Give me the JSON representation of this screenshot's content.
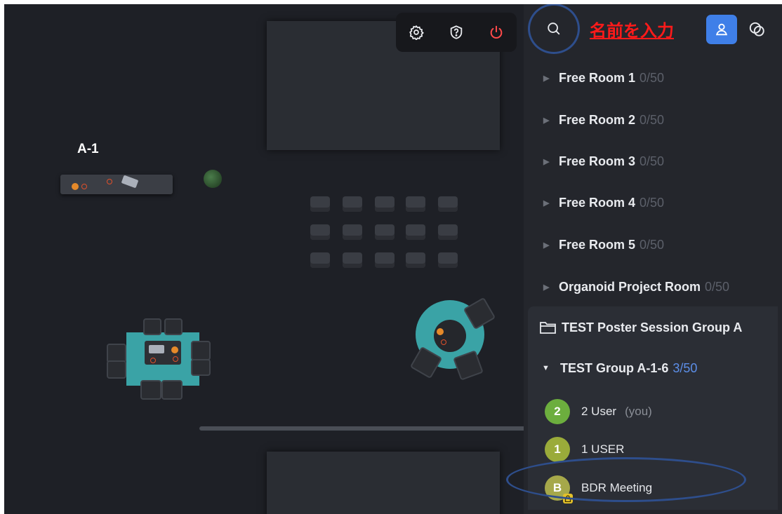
{
  "map": {
    "desk_label": "A-1"
  },
  "toolbar": {
    "settings_icon": "gear-icon",
    "help_icon": "help-icon",
    "power_icon": "power-icon",
    "power_color": "#ff4a4a"
  },
  "header": {
    "search_icon": "search-icon",
    "name_hint": "名前を入力",
    "hint_color": "#ff1a1a",
    "user_icon": "user-icon",
    "user_btn_color": "#3f7fe8",
    "chat_icon": "chat-icon"
  },
  "rooms": [
    {
      "name": "Free Room 1",
      "count": "0/50"
    },
    {
      "name": "Free Room 2",
      "count": "0/50"
    },
    {
      "name": "Free Room 3",
      "count": "0/50"
    },
    {
      "name": "Free Room 4",
      "count": "0/50"
    },
    {
      "name": "Free Room 5",
      "count": "0/50"
    },
    {
      "name": "Organoid Project Room",
      "count": "0/50"
    }
  ],
  "group": {
    "title": "TEST Poster Session Group A",
    "subgroup": {
      "name": "TEST Group A-1-6",
      "count": "3/50"
    },
    "users": [
      {
        "initial": "2",
        "name": "2 User",
        "note": "(you)",
        "color": "#6cae3e"
      },
      {
        "initial": "1",
        "name": "1 USER",
        "note": "",
        "color": "#9aab3a"
      },
      {
        "initial": "B",
        "name": "BDR Meeting",
        "note": "",
        "color": "#a6a84a"
      }
    ]
  }
}
